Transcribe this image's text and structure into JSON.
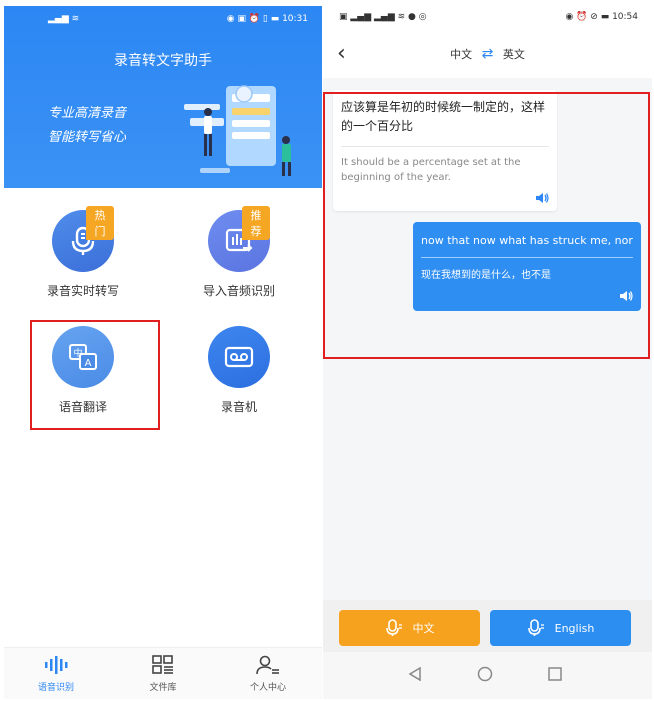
{
  "left": {
    "status": {
      "signal": "⁴⁶.ıl ",
      "time": "10:31"
    },
    "title": "录音转文字助手",
    "slogan": [
      "专业高清录音",
      "智能转写省心"
    ],
    "grid": [
      {
        "label": "录音实时转写",
        "tag": "热门",
        "icon": "microphone-icon"
      },
      {
        "label": "导入音频识别",
        "tag": "推荐",
        "icon": "audio-import-icon"
      },
      {
        "label": "语音翻译",
        "tag": "",
        "icon": "translate-icon"
      },
      {
        "label": "录音机",
        "tag": "",
        "icon": "recorder-icon"
      }
    ],
    "tabs": [
      {
        "label": "语音识别",
        "icon": "waveform-icon",
        "active": true
      },
      {
        "label": "文件库",
        "icon": "grid-icon",
        "active": false
      },
      {
        "label": "个人中心",
        "icon": "user-icon",
        "active": false
      }
    ]
  },
  "right": {
    "status": {
      "time": "10:54"
    },
    "lang_from": "中文",
    "lang_to": "英文",
    "messages": [
      {
        "side": "left",
        "source": "应该算是年初的时候统一制定的，这样的一个百分比",
        "translation": "It should be a percentage set at the beginning of the year."
      },
      {
        "side": "right",
        "source": "now that now what has struck me, nor",
        "translation": "现在我想到的是什么，也不是"
      }
    ],
    "buttons": {
      "zh": "中文",
      "en": "English"
    }
  },
  "colors": {
    "accent": "#2c87f4",
    "orange": "#f6a21e",
    "highlight": "#e02020"
  }
}
